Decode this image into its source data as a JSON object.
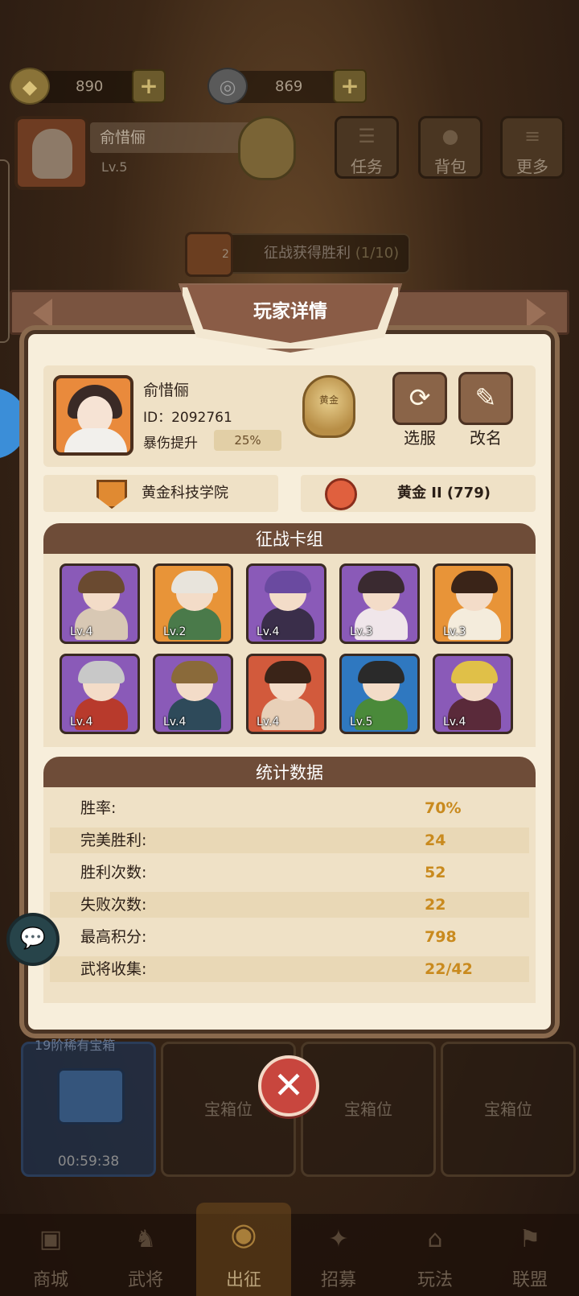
{
  "resources": {
    "gold": "890",
    "coins": "869",
    "plus_glyph": "+"
  },
  "player_bar": {
    "name": "俞惜俪",
    "level": "Lv.5",
    "rank_glyph": "黄金",
    "menu": [
      {
        "label": "任务",
        "icon": "scroll-icon"
      },
      {
        "label": "背包",
        "icon": "bag-icon"
      },
      {
        "label": "更多",
        "icon": "menu-icon"
      }
    ]
  },
  "quest": {
    "count": "2",
    "label": "征战获得胜利",
    "progress": "(1/10)"
  },
  "modal": {
    "title": "玩家详情",
    "player": {
      "name": "俞惜俪",
      "id": "ID：2092761",
      "crit_label": "暴伤提升",
      "crit_value": "25%",
      "rank_glyph": "黄金"
    },
    "actions": {
      "server_label": "选服",
      "rename_label": "改名"
    },
    "guild": "黄金科技学院",
    "tier": "黄金 II (779)",
    "deck_title": "征战卡组",
    "deck": [
      {
        "level": "Lv.4",
        "color": "purple",
        "hair": "#6a4a30",
        "body": "#d8c8b4"
      },
      {
        "level": "Lv.2",
        "color": "orange",
        "hair": "#e8e4dc",
        "body": "#4a7a4a"
      },
      {
        "level": "Lv.4",
        "color": "purple",
        "hair": "#6a4aa0",
        "body": "#3a2e4a"
      },
      {
        "level": "Lv.3",
        "color": "purple",
        "hair": "#3a2a30",
        "body": "#f0e6ea"
      },
      {
        "level": "Lv.3",
        "color": "orange",
        "hair": "#3a2418",
        "body": "#f4ecdc"
      },
      {
        "level": "Lv.4",
        "color": "purple",
        "hair": "#c8c8c8",
        "body": "#b83a2c"
      },
      {
        "level": "Lv.4",
        "color": "purple",
        "hair": "#8a6a3a",
        "body": "#2e4a5a"
      },
      {
        "level": "Lv.4",
        "color": "red",
        "hair": "#3a2418",
        "body": "#e8d0b8"
      },
      {
        "level": "Lv.5",
        "color": "blue",
        "hair": "#2a2a2a",
        "body": "#4a8a3a"
      },
      {
        "level": "Lv.4",
        "color": "purple",
        "hair": "#e0c048",
        "body": "#5a2a3a"
      }
    ],
    "stats_title": "统计数据",
    "stats": [
      {
        "label": "胜率:",
        "value": "70%"
      },
      {
        "label": "完美胜利:",
        "value": "24"
      },
      {
        "label": "胜利次数:",
        "value": "52"
      },
      {
        "label": "失败次数:",
        "value": "22"
      },
      {
        "label": "最高积分:",
        "value": "798"
      },
      {
        "label": "武将收集:",
        "value": "22/42"
      }
    ],
    "close_glyph": "✕"
  },
  "chests": {
    "first_title": "19阶稀有宝箱",
    "first_timer": "00:59:38",
    "slot_label": "宝箱位"
  },
  "bottom_nav": [
    {
      "label": "商城"
    },
    {
      "label": "武将"
    },
    {
      "label": "出征"
    },
    {
      "label": "招募"
    },
    {
      "label": "玩法"
    },
    {
      "label": "联盟"
    }
  ],
  "colors": {
    "accent_gold_value": "#c98a1e",
    "header_brown": "#6e4c38",
    "close_red": "#c8463e"
  }
}
